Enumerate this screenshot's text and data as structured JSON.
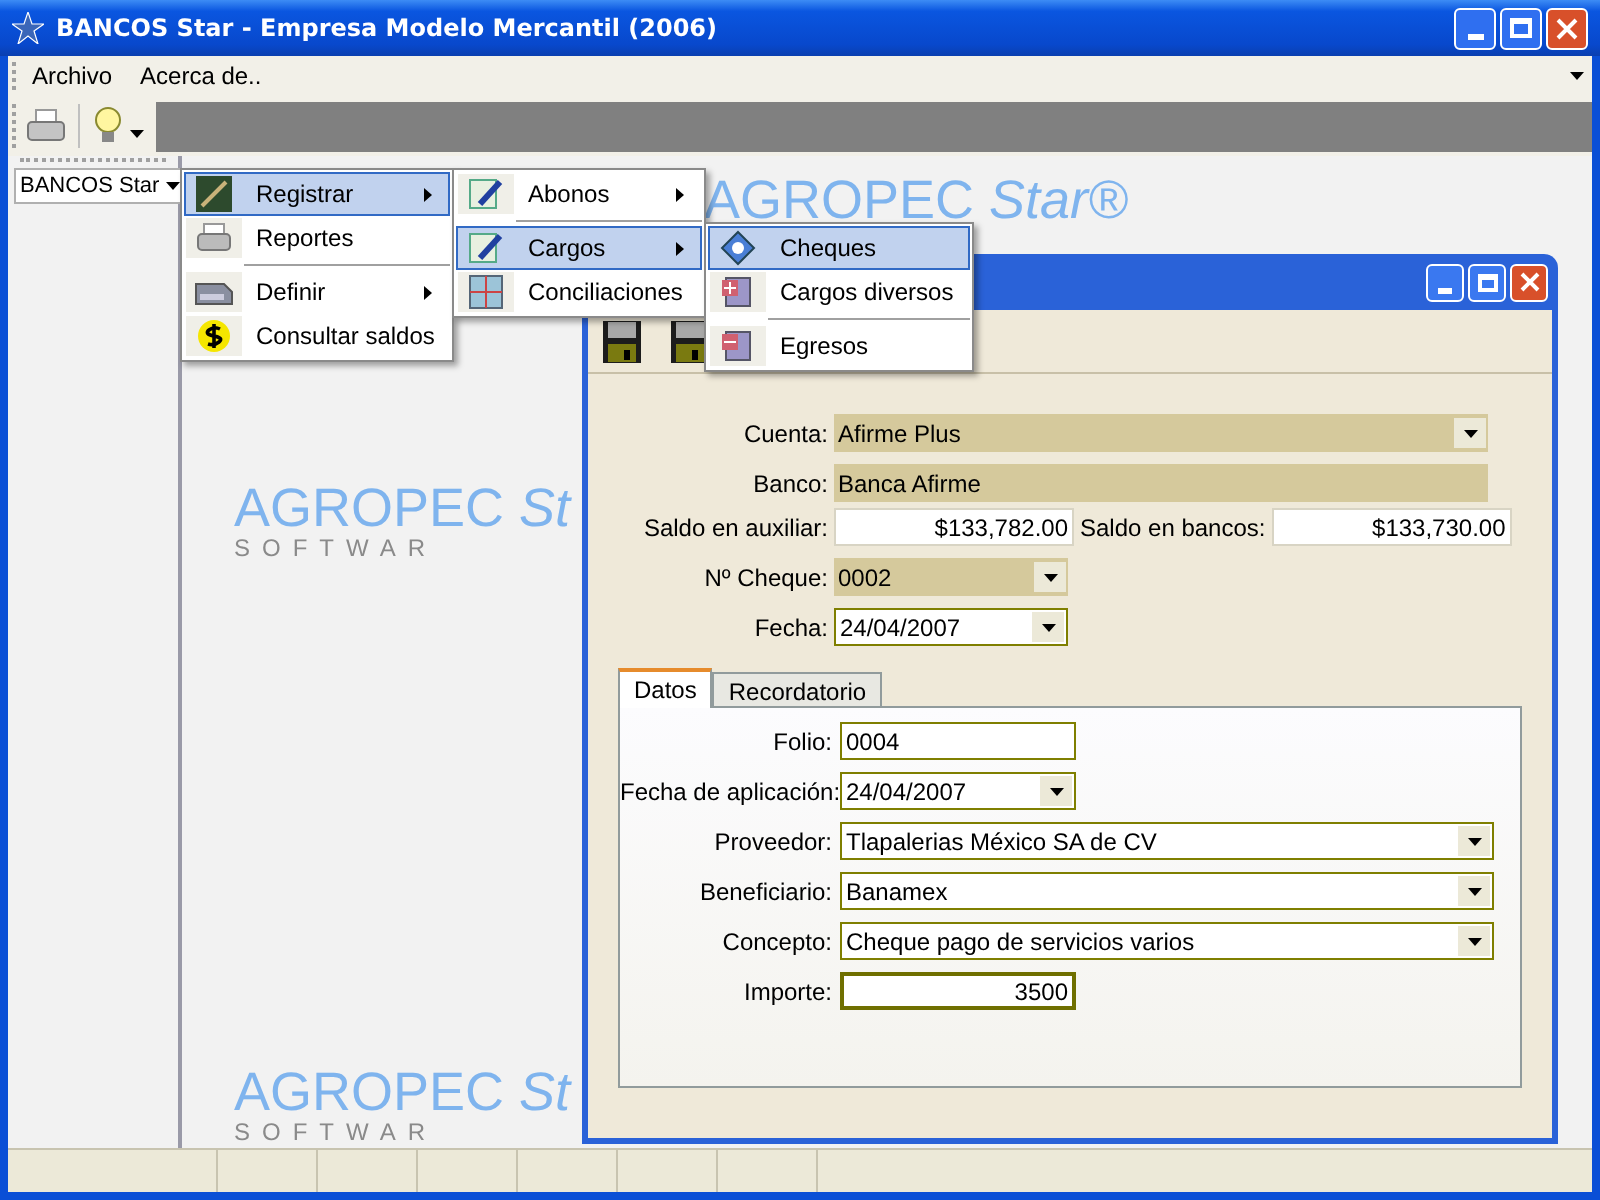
{
  "window": {
    "title": "BANCOS Star - Empresa Modelo Mercantil (2006)"
  },
  "menu_bar": [
    {
      "label": "Archivo"
    },
    {
      "label": "Acerca de.."
    }
  ],
  "side_panel": {
    "button": "BANCOS Star"
  },
  "backdrop_logos": [
    {
      "brand": "AGROPEC *Star®*"
    },
    {
      "brand": "AGROPEC *St*",
      "tagline": "SOFTWAR"
    },
    {
      "brand": "AGROPEC *St*",
      "tagline": "SOFTWAR"
    }
  ],
  "menus": [
    [
      {
        "kind": "item",
        "label": "Registrar",
        "selected": true,
        "submenu": true
      },
      {
        "kind": "item",
        "label": "Reportes",
        "selected": false,
        "submenu": false
      },
      {
        "kind": "separator"
      },
      {
        "kind": "item",
        "label": "Definir",
        "selected": false,
        "submenu": true
      },
      {
        "kind": "item",
        "label": "Consultar saldos",
        "selected": false,
        "submenu": false
      }
    ],
    [
      {
        "kind": "item",
        "label": "Abonos",
        "selected": false,
        "submenu": true
      },
      {
        "kind": "separator"
      },
      {
        "kind": "item",
        "label": "Cargos",
        "selected": true,
        "submenu": true
      },
      {
        "kind": "item",
        "label": "Conciliaciones",
        "selected": false,
        "submenu": false
      }
    ],
    [
      {
        "kind": "item",
        "label": "Cheques",
        "selected": true,
        "submenu": false
      },
      {
        "kind": "item",
        "label": "Cargos diversos",
        "selected": false,
        "submenu": false
      },
      {
        "kind": "separator"
      },
      {
        "kind": "item",
        "label": "Egresos",
        "selected": false,
        "submenu": false
      }
    ]
  ],
  "child_window": {
    "header_fields": [
      {
        "kind": "combo",
        "label": "Cuenta:",
        "value": "Afirme Plus",
        "readonly": true
      },
      {
        "kind": "text",
        "label": "Banco:",
        "value": "Banca Afirme",
        "readonly": true
      },
      {
        "kind": "pair",
        "label": "Saldo en auxiliar:",
        "value": "$133,782.00",
        "label_2": "Saldo en bancos:",
        "value_2": "$133,730.00"
      },
      {
        "kind": "short_combo",
        "label": "Nº Cheque:",
        "value": "0002",
        "readonly": true
      },
      {
        "kind": "short_combo",
        "label": "Fecha:",
        "value": "24/04/2007",
        "readonly": false
      }
    ],
    "tabs": [
      {
        "label": "Datos",
        "selected": true
      },
      {
        "label": "Recordatorio",
        "selected": false
      }
    ],
    "tab_fields": [
      {
        "kind": "short_text",
        "label": "Folio:",
        "value": "0004",
        "focused": false
      },
      {
        "kind": "short_combo",
        "label": "Fecha de aplicación:",
        "value": "24/04/2007",
        "focused": false
      },
      {
        "kind": "combo",
        "label": "Proveedor:",
        "value": "Tlapalerias México SA de CV",
        "focused": false
      },
      {
        "kind": "combo",
        "label": "Beneficiario:",
        "value": "Banamex",
        "focused": false
      },
      {
        "kind": "combo",
        "label": "Concepto:",
        "value": "Cheque pago de servicios varios",
        "focused": false
      },
      {
        "kind": "amount",
        "label": "Importe:",
        "value": "3500",
        "focused": true
      }
    ]
  }
}
